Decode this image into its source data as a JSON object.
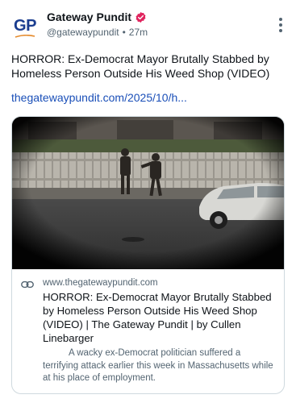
{
  "header": {
    "avatar_text": "GP",
    "display_name": "Gateway Pundit",
    "handle": "@gatewaypundit",
    "separator": "•",
    "timestamp": "27m",
    "verified_icon": "verified-badge-icon",
    "more_icon": "more-vertical-icon"
  },
  "post": {
    "text": "HORROR: Ex-Democrat Mayor Brutally Stabbed by Homeless Person Outside His Weed Shop (VIDEO)",
    "link_text": "thegatewaypundit.com/2025/10/h..."
  },
  "card": {
    "domain": "www.thegatewaypundit.com",
    "title": "HORROR: Ex-Democrat Mayor Brutally Stabbed by Homeless Person Outside His Weed Shop (VIDEO) | The Gateway Pundit | by Cullen Linebarger",
    "description": "A wacky ex-Democrat politician suffered a terrifying attack earlier this week in Massachusetts while at his place of employment.",
    "link_icon": "link-chain-icon"
  },
  "colors": {
    "brand_blue": "#1a3d8f",
    "brand_orange": "#e58a2b",
    "verified": "#e0245e",
    "link": "#1a4fb8",
    "muted": "#536471"
  }
}
